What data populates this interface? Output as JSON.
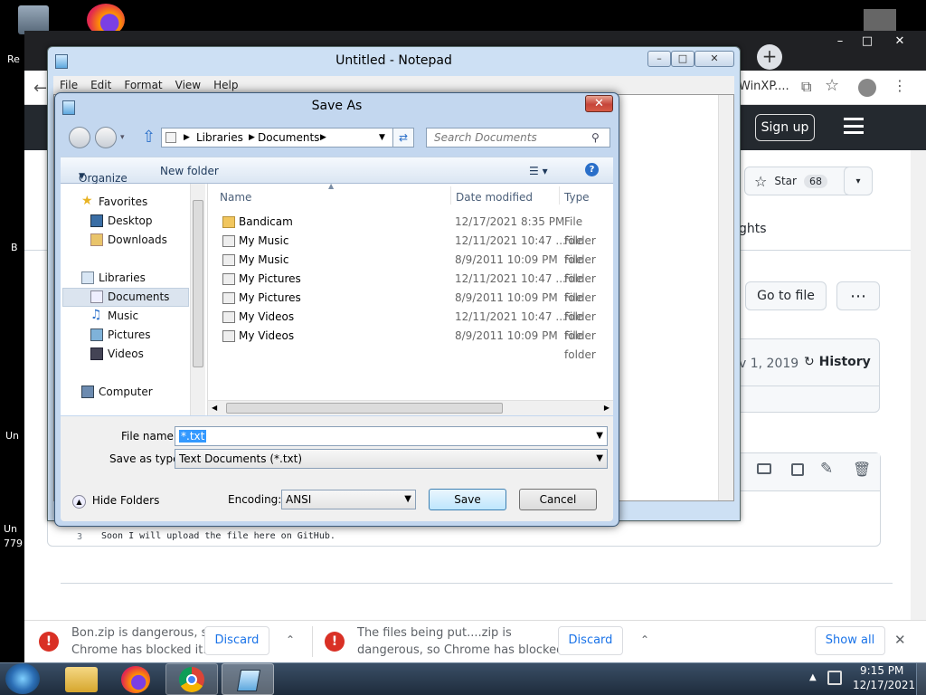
{
  "desktop": {
    "left_labels": [
      "Re",
      "B",
      "Un",
      "Un",
      "779"
    ]
  },
  "chrome": {
    "address_partial": "WinXP....",
    "gh": {
      "signup": "Sign up",
      "star_label": "Star",
      "star_count": "68",
      "insights_partial": "ghts",
      "goto_file": "Go to file",
      "more": "⋯",
      "date_partial": "v 1, 2019",
      "history": "History",
      "code_line_num": "3",
      "code_line": "Soon I will upload the file here on GitHub."
    }
  },
  "notepad": {
    "title": "Untitled - Notepad",
    "menu": [
      "File",
      "Edit",
      "Format",
      "View",
      "Help"
    ]
  },
  "dialog": {
    "title": "Save As",
    "breadcrumb": [
      "Libraries",
      "Documents"
    ],
    "search_placeholder": "Search Documents",
    "organize": "Organize",
    "new_folder": "New folder",
    "nav": {
      "favorites": "Favorites",
      "desktop": "Desktop",
      "downloads": "Downloads",
      "libraries": "Libraries",
      "documents": "Documents",
      "music": "Music",
      "pictures": "Pictures",
      "videos": "Videos",
      "computer": "Computer"
    },
    "columns": {
      "name": "Name",
      "date": "Date modified",
      "type": "Type"
    },
    "files": [
      {
        "name": "Bandicam",
        "date": "12/17/2021 8:35 PM",
        "type": "File folder"
      },
      {
        "name": "My Music",
        "date": "12/11/2021 10:47 ...",
        "type": "File folder"
      },
      {
        "name": "My Music",
        "date": "8/9/2011 10:09 PM",
        "type": "File folder"
      },
      {
        "name": "My Pictures",
        "date": "12/11/2021 10:47 ...",
        "type": "File folder"
      },
      {
        "name": "My Pictures",
        "date": "8/9/2011 10:09 PM",
        "type": "File folder"
      },
      {
        "name": "My Videos",
        "date": "12/11/2021 10:47 ...",
        "type": "File folder"
      },
      {
        "name": "My Videos",
        "date": "8/9/2011 10:09 PM",
        "type": "File folder"
      }
    ],
    "file_name_label": "File name:",
    "file_name_value": "*.txt",
    "save_type_label": "Save as type:",
    "save_type_value": "Text Documents (*.txt)",
    "hide_folders": "Hide Folders",
    "encoding_label": "Encoding:",
    "encoding_value": "ANSI",
    "save": "Save",
    "cancel": "Cancel"
  },
  "downloads": {
    "item1_line1": "Bon.zip is dangerous, so",
    "item1_line2": "Chrome has blocked it.",
    "item2_line1": "The files being put....zip is",
    "item2_line2": "dangerous, so Chrome has blocked it.",
    "discard": "Discard",
    "show_all": "Show all"
  },
  "taskbar": {
    "time": "9:15 PM",
    "date": "12/17/2021"
  }
}
